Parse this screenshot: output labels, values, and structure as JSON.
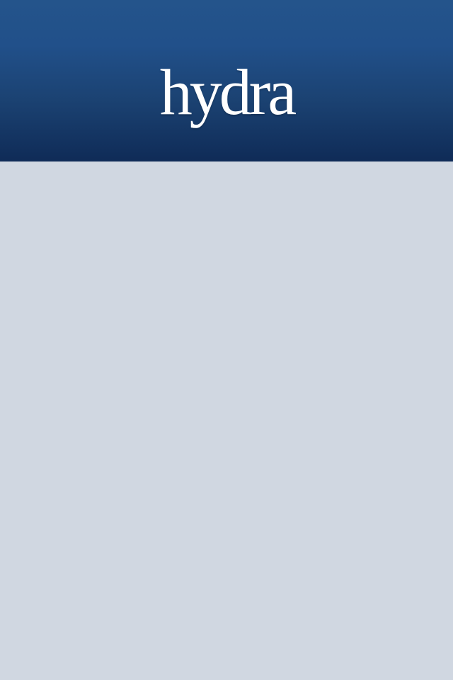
{
  "app": {
    "logo_text": "hydra"
  },
  "colors": {
    "header_top": "#24548b",
    "header_bottom": "#0f2b57",
    "background": "#d0d7e1",
    "logo": "#ffffff"
  }
}
